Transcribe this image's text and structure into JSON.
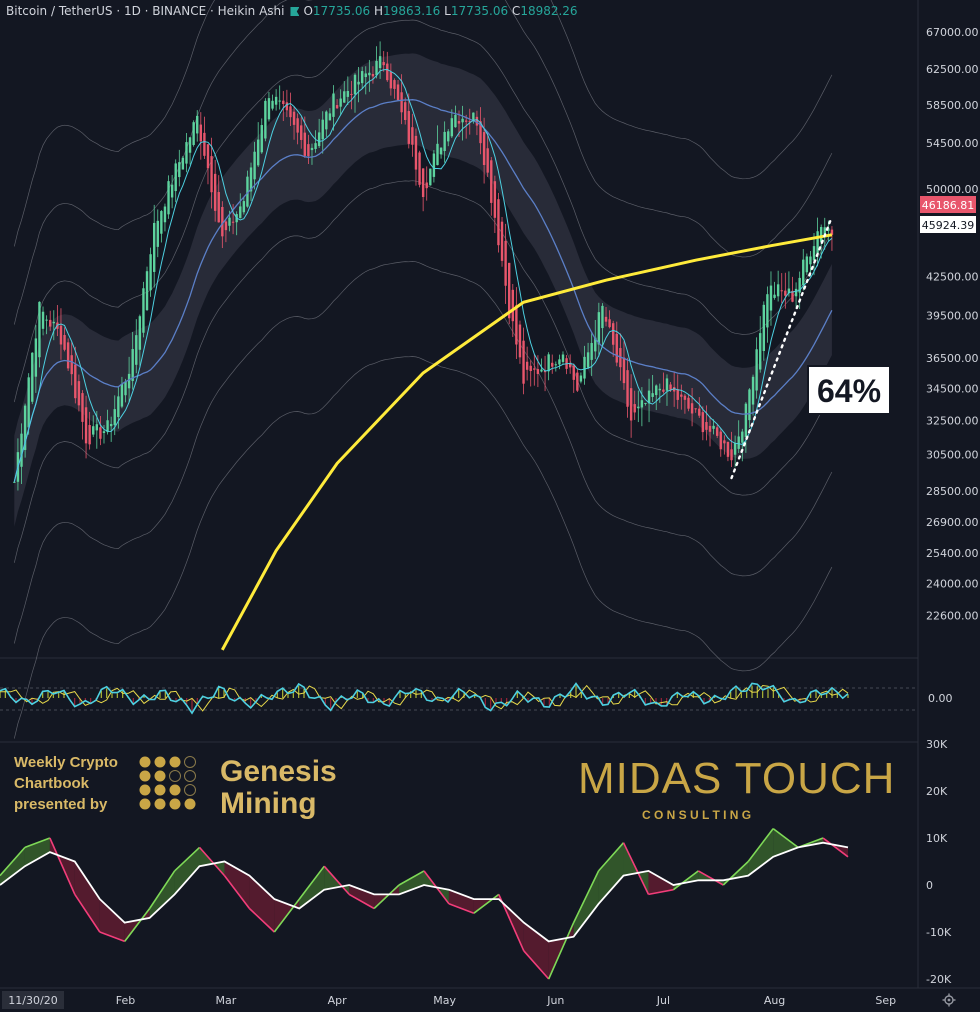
{
  "header": {
    "symbol": "Bitcoin / TetherUS · 1D · BINANCE · Heikin Ashi",
    "o_label": "O",
    "o": "17735.06",
    "h_label": "H",
    "h": "19863.16",
    "l_label": "L",
    "l": "17735.06",
    "c_label": "C",
    "c": "18982.26"
  },
  "price_axis": {
    "ticks": [
      "67000.00",
      "62500.00",
      "58500.00",
      "54500.00",
      "50000.00",
      "42500.00",
      "39500.00",
      "36500.00",
      "34500.00",
      "32500.00",
      "30500.00",
      "28500.00",
      "26900.00",
      "25400.00",
      "24000.00",
      "22600.00"
    ],
    "last_price": "46186.81",
    "ma_price": "45924.39"
  },
  "osc_axis": {
    "ticks": [
      "0.00"
    ]
  },
  "momentum_axis": {
    "ticks": [
      "30K",
      "20K",
      "10K",
      "0",
      "-10K",
      "-20K"
    ]
  },
  "time_axis": {
    "start_label": "11/30/20",
    "months": [
      "Feb",
      "Mar",
      "Apr",
      "May",
      "Jun",
      "Jul",
      "Aug",
      "Sep"
    ]
  },
  "annotation": {
    "label": "64%"
  },
  "branding": {
    "weekly_line1": "Weekly Crypto",
    "weekly_line2": "Chartbook",
    "weekly_line3": "presented by",
    "genesis_line1": "Genesis",
    "genesis_line2": "Mining",
    "midas": "MIDAS TOUCH",
    "consulting": "C O N S U L T I N G"
  },
  "colors": {
    "background": "#131722",
    "up": "#5dd39e",
    "down": "#e8566c",
    "ma200": "#ffeb3b",
    "midline": "#5b7fc7",
    "fast_ma": "#4dd0e1",
    "envelope": "#9598a1",
    "gold": "#c9a646"
  },
  "chart_data": [
    {
      "type": "candlestick",
      "title": "Bitcoin / TetherUS 1D BINANCE Heikin Ashi",
      "x_range": [
        "2020-11-30",
        "2021-09-10"
      ],
      "y_scale": "log",
      "ylim": [
        21000,
        68500
      ],
      "ohlc_readout": {
        "open": 17735.06,
        "high": 19863.16,
        "low": 17735.06,
        "close": 18982.26
      },
      "last_price": 46186.81,
      "ma200_last": 45924.39,
      "close_path": [
        [
          "2021-01-01",
          29000
        ],
        [
          "2021-01-08",
          40000
        ],
        [
          "2021-01-14",
          38000
        ],
        [
          "2021-01-21",
          31500
        ],
        [
          "2021-01-27",
          32000
        ],
        [
          "2021-02-03",
          36500
        ],
        [
          "2021-02-09",
          46500
        ],
        [
          "2021-02-21",
          57000
        ],
        [
          "2021-02-28",
          45500
        ],
        [
          "2021-03-06",
          49000
        ],
        [
          "2021-03-13",
          60000
        ],
        [
          "2021-03-24",
          53500
        ],
        [
          "2021-03-31",
          58800
        ],
        [
          "2021-04-14",
          63500
        ],
        [
          "2021-04-25",
          50000
        ],
        [
          "2021-05-03",
          57500
        ],
        [
          "2021-05-10",
          57000
        ],
        [
          "2021-05-19",
          40000
        ],
        [
          "2021-05-23",
          35000
        ],
        [
          "2021-06-03",
          37000
        ],
        [
          "2021-06-07",
          34500
        ],
        [
          "2021-06-14",
          40000
        ],
        [
          "2021-06-22",
          32500
        ],
        [
          "2021-07-01",
          34800
        ],
        [
          "2021-07-20",
          30500
        ],
        [
          "2021-07-24",
          33000
        ],
        [
          "2021-07-30",
          41500
        ],
        [
          "2021-08-06",
          41000
        ],
        [
          "2021-08-14",
          47000
        ],
        [
          "2021-08-17",
          46186
        ]
      ],
      "ma200": [
        [
          "2021-02-28",
          21200
        ],
        [
          "2021-03-15",
          25500
        ],
        [
          "2021-04-01",
          30000
        ],
        [
          "2021-04-25",
          35500
        ],
        [
          "2021-05-23",
          40500
        ],
        [
          "2021-06-15",
          42200
        ],
        [
          "2021-07-10",
          43800
        ],
        [
          "2021-07-31",
          45000
        ],
        [
          "2021-08-17",
          45924
        ]
      ],
      "annotation": {
        "text": "64%",
        "trend_from": [
          "2021-07-20",
          29200
        ],
        "trend_to": [
          "2021-08-17",
          47500
        ]
      }
    },
    {
      "type": "line",
      "title": "",
      "ylim": [
        -1,
        1
      ],
      "series": [
        {
          "values": [
            0.4,
            -0.3,
            0.5,
            -0.5,
            0.6,
            -0.2,
            0.3,
            -0.6,
            0.5,
            -0.4,
            0.2,
            0.6,
            -0.5,
            0.3,
            -0.4,
            0.5,
            -0.2,
            0.4,
            -0.6,
            0.2,
            -0.4,
            0.6,
            -0.3,
            0.4,
            -0.5,
            0.3,
            -0.2,
            0.5,
            0.7,
            -0.3,
            0.4,
            0.2
          ]
        }
      ]
    },
    {
      "type": "line",
      "title": "",
      "ylim": [
        -20000,
        30000
      ],
      "series": [
        {
          "values": [
            2000,
            8000,
            10000,
            -2000,
            -10000,
            -12000,
            -5000,
            3000,
            8000,
            2000,
            -5000,
            -10000,
            -3000,
            4000,
            -2000,
            -5000,
            0,
            3000,
            -4000,
            -6000,
            -2000,
            -14000,
            -20000,
            -8000,
            3000,
            9000,
            -2000,
            -1000,
            3000,
            0,
            5000,
            12000,
            8000,
            10000,
            6000
          ]
        },
        {
          "values": [
            0,
            4000,
            7000,
            5000,
            -3000,
            -8000,
            -7000,
            -2000,
            4000,
            5000,
            2000,
            -3000,
            -5000,
            -1000,
            0,
            -2000,
            -2000,
            0,
            -1000,
            -3000,
            -3000,
            -8000,
            -12000,
            -11000,
            -4000,
            2000,
            3000,
            0,
            1000,
            1000,
            2000,
            6000,
            8000,
            9000,
            8000
          ]
        }
      ]
    }
  ]
}
